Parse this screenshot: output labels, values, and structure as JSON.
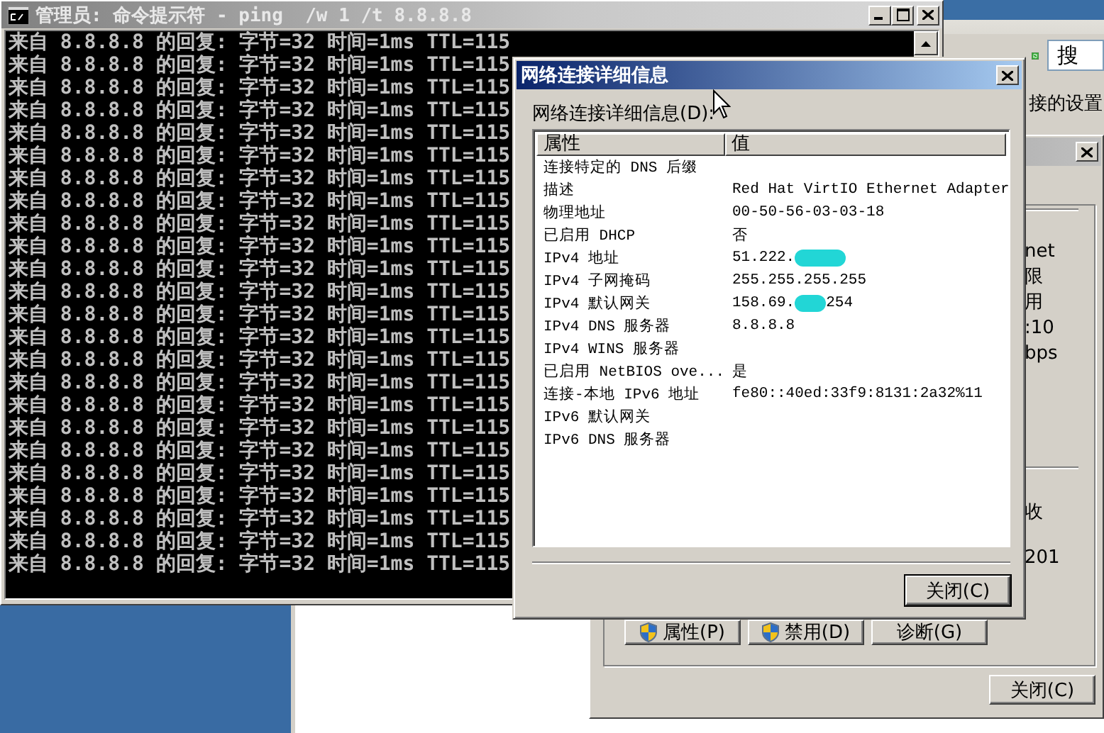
{
  "explorer_window": {
    "search": {
      "placeholder": "搜"
    },
    "breadcrumb": "接的设置"
  },
  "status_window": {
    "partial_texts": [
      "net",
      "限",
      "用",
      ":10",
      "bps",
      "收",
      "201"
    ],
    "buttons": [
      {
        "label": "属性(P)",
        "shield": true
      },
      {
        "label": "禁用(D)",
        "shield": true
      },
      {
        "label": "诊断(G)",
        "shield": false
      }
    ],
    "close_button": "关闭(C)"
  },
  "console_window": {
    "title": "管理员: 命令提示符 - ping  /w 1 /t 8.8.8.8",
    "lines": [
      "来自 8.8.8.8 的回复: 字节=32 时间=1ms TTL=115",
      "来自 8.8.8.8 的回复: 字节=32 时间=1ms TTL=115",
      "来自 8.8.8.8 的回复: 字节=32 时间=1ms TTL=115",
      "来自 8.8.8.8 的回复: 字节=32 时间=1ms TTL=115",
      "来自 8.8.8.8 的回复: 字节=32 时间=1ms TTL=115",
      "来自 8.8.8.8 的回复: 字节=32 时间=1ms TTL=115",
      "来自 8.8.8.8 的回复: 字节=32 时间=1ms TTL=115",
      "来自 8.8.8.8 的回复: 字节=32 时间=1ms TTL=115",
      "来自 8.8.8.8 的回复: 字节=32 时间=1ms TTL=115",
      "来自 8.8.8.8 的回复: 字节=32 时间=1ms TTL=115",
      "来自 8.8.8.8 的回复: 字节=32 时间=1ms TTL=115",
      "来自 8.8.8.8 的回复: 字节=32 时间=1ms TTL=115",
      "来自 8.8.8.8 的回复: 字节=32 时间=1ms TTL=115",
      "来自 8.8.8.8 的回复: 字节=32 时间=1ms TTL=115",
      "来自 8.8.8.8 的回复: 字节=32 时间=1ms TTL=115",
      "来自 8.8.8.8 的回复: 字节=32 时间=1ms TTL=115",
      "来自 8.8.8.8 的回复: 字节=32 时间=1ms TTL=115",
      "来自 8.8.8.8 的回复: 字节=32 时间=1ms TTL=115",
      "来自 8.8.8.8 的回复: 字节=32 时间=1ms TTL=115",
      "来自 8.8.8.8 的回复: 字节=32 时间=1ms TTL=115",
      "来自 8.8.8.8 的回复: 字节=32 时间=1ms TTL=115",
      "来自 8.8.8.8 的回复: 字节=32 时间=1ms TTL=115",
      "来自 8.8.8.8 的回复: 字节=32 时间=1ms TTL=115",
      "来自 8.8.8.8 的回复: 字节=32 时间=1ms TTL=115"
    ]
  },
  "details_dialog": {
    "title": "网络连接详细信息",
    "list_label": "网络连接详细信息(D):",
    "columns": [
      "属性",
      "值"
    ],
    "rows": [
      {
        "property": "连接特定的 DNS 后缀",
        "value": "",
        "redacted": false
      },
      {
        "property": "描述",
        "value": "Red Hat VirtIO Ethernet Adapter",
        "redacted": false
      },
      {
        "property": "物理地址",
        "value": "00-50-56-03-03-18",
        "redacted": false
      },
      {
        "property": "已启用 DHCP",
        "value": "否",
        "redacted": false
      },
      {
        "property": "IPv4 地址",
        "value": "51.222.",
        "redacted": true
      },
      {
        "property": "IPv4 子网掩码",
        "value": "255.255.255.255",
        "redacted": false
      },
      {
        "property": "IPv4 默认网关",
        "value": "158.69.",
        "redacted": true,
        "value_suffix": "254"
      },
      {
        "property": "IPv4 DNS 服务器",
        "value": "8.8.8.8",
        "redacted": false
      },
      {
        "property": "IPv4 WINS 服务器",
        "value": "",
        "redacted": false
      },
      {
        "property": "已启用 NetBIOS ove...",
        "value": "是",
        "redacted": false
      },
      {
        "property": "连接-本地 IPv6 地址",
        "value": "fe80::40ed:33f9:8131:2a32%11",
        "redacted": false
      },
      {
        "property": "IPv6 默认网关",
        "value": "",
        "redacted": false
      },
      {
        "property": "IPv6 DNS 服务器",
        "value": "",
        "redacted": false
      }
    ],
    "close_button": "关闭(C)"
  }
}
